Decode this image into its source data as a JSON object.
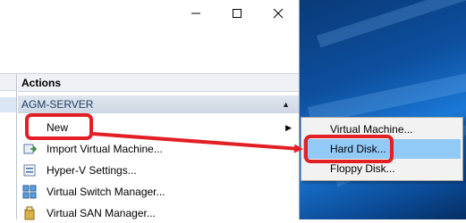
{
  "window": {
    "controls": {
      "minimize": "minimize",
      "maximize": "maximize",
      "close": "close"
    }
  },
  "actions": {
    "header": "Actions",
    "group": "AGM-SERVER",
    "items": [
      {
        "label": "New",
        "icon": "none",
        "has_submenu": true
      },
      {
        "label": "Import Virtual Machine...",
        "icon": "import-icon"
      },
      {
        "label": "Hyper-V Settings...",
        "icon": "settings-icon"
      },
      {
        "label": "Virtual Switch Manager...",
        "icon": "switch-icon"
      },
      {
        "label": "Virtual SAN Manager...",
        "icon": "san-icon"
      }
    ]
  },
  "submenu": {
    "items": [
      {
        "label": "Virtual Machine..."
      },
      {
        "label": "Hard Disk...",
        "highlighted": true
      },
      {
        "label": "Floppy Disk..."
      }
    ]
  },
  "annotation": {
    "color": "#e31f26"
  }
}
